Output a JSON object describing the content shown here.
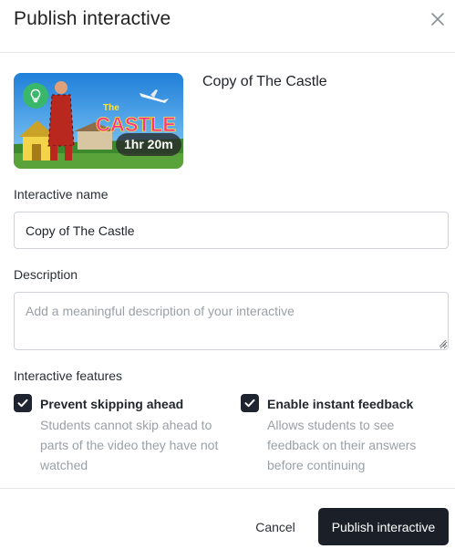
{
  "dialog": {
    "title": "Publish interactive",
    "close_icon": "close-icon"
  },
  "video": {
    "title": "Copy of The Castle",
    "duration": "1hr 20m",
    "thumbnail_text_top": "The",
    "thumbnail_text_main": "CASTLE",
    "thumbnail_icon": "lightbulb-icon"
  },
  "fields": {
    "name_label": "Interactive name",
    "name_value": "Copy of The Castle",
    "description_label": "Description",
    "description_placeholder": "Add a meaningful description of your interactive",
    "description_value": ""
  },
  "features": {
    "label": "Interactive features",
    "items": [
      {
        "title": "Prevent skipping ahead",
        "description": "Students cannot skip ahead to parts of the video they have not watched",
        "checked": true
      },
      {
        "title": "Enable instant feedback",
        "description": "Allows students to see feedback on their answers before continuing",
        "checked": true
      }
    ]
  },
  "actions": {
    "cancel_label": "Cancel",
    "publish_label": "Publish interactive"
  },
  "colors": {
    "primary_button": "#1b1f27",
    "checkbox": "#1e2430",
    "badge_green": "#39b86b"
  }
}
